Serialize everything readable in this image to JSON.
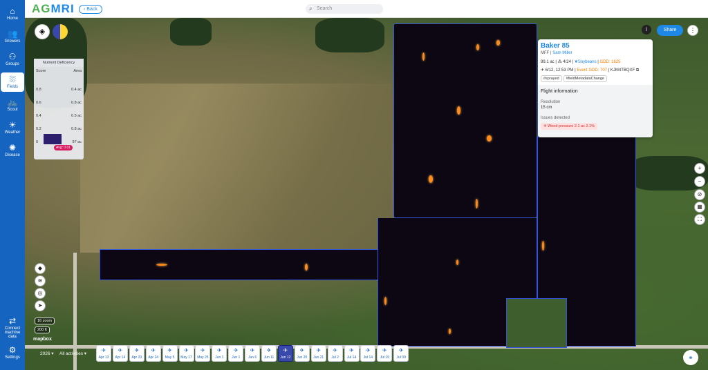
{
  "sidebar": {
    "items": [
      {
        "label": "Home",
        "icon": "home-icon",
        "glyph": "⌂"
      },
      {
        "label": "Growers",
        "icon": "growers-icon",
        "glyph": "👥"
      },
      {
        "label": "Groups",
        "icon": "groups-icon",
        "glyph": "⚇"
      },
      {
        "label": "Fields",
        "icon": "fields-icon",
        "glyph": "⛆"
      },
      {
        "label": "Scout",
        "icon": "scout-icon",
        "glyph": "🚲"
      },
      {
        "label": "Weather",
        "icon": "weather-icon",
        "glyph": "☀"
      },
      {
        "label": "Disease",
        "icon": "disease-icon",
        "glyph": "✺"
      }
    ],
    "bottom": [
      {
        "label": "Connect machine data",
        "icon": "connect-icon",
        "glyph": "⇄"
      },
      {
        "label": "Settings",
        "icon": "settings-icon",
        "glyph": "⚙"
      }
    ]
  },
  "header": {
    "logo_a": "AG",
    "logo_b": "MRI",
    "back_label": "Back",
    "search_placeholder": "Search"
  },
  "deficiency": {
    "title": "Nutrient Deficiency",
    "score_header": "Score",
    "area_header": "Area",
    "rows": [
      {
        "score": "0.8",
        "area": "0.4 ac"
      },
      {
        "score": "0.6",
        "area": "0.8 ac"
      },
      {
        "score": "0.4",
        "area": "0.5 ac"
      },
      {
        "score": "0.2",
        "area": "0.8 ac"
      },
      {
        "score": "0",
        "area": "97 ac"
      }
    ],
    "avg_label": "Avg: 0.01"
  },
  "card": {
    "title": "Baker 85",
    "org": "MFF",
    "owner": "Sam Miller",
    "acres": "99.1 ac",
    "planted": "4/24",
    "crop": "Soybeans",
    "gdd": "GDD: 1625",
    "flight_date": "6/12, 12:53 PM",
    "event_gdd": "Event GDD: 707",
    "flight_code": "KJM4TBQXF",
    "tags": [
      "#sprayed",
      "#fieldMetadataChange"
    ],
    "flight_header": "Flight information",
    "resolution_label": "Resolution",
    "resolution_value": "15 cm",
    "issues_label": "Issues detected",
    "issue": "Weed pressure  2.1 ac  2.1%"
  },
  "toolbar": {
    "share_label": "Share",
    "zoom_label": "16 zoom",
    "scale_label": "200 ft",
    "mapbox_label": "mapbox"
  },
  "timeline": {
    "year": "2026",
    "activity_filter": "All activities",
    "dates": [
      "Apr 13",
      "Apr 14",
      "Apr 23",
      "Apr 24",
      "May 5",
      "May 17",
      "May 25",
      "Jun 1",
      "Jun 1",
      "Jun 6",
      "Jun 11",
      "Jun 12",
      "Jun 20",
      "Jun 21",
      "Jul 2",
      "Jul 14",
      "Jul 14",
      "Jul 19",
      "Jul 30"
    ],
    "active_index": 11
  },
  "colors": {
    "brand_blue": "#1565c0",
    "accent": "#1e88e5",
    "hotspot": "#ff8a1e",
    "field_boundary": "#3355dd"
  }
}
